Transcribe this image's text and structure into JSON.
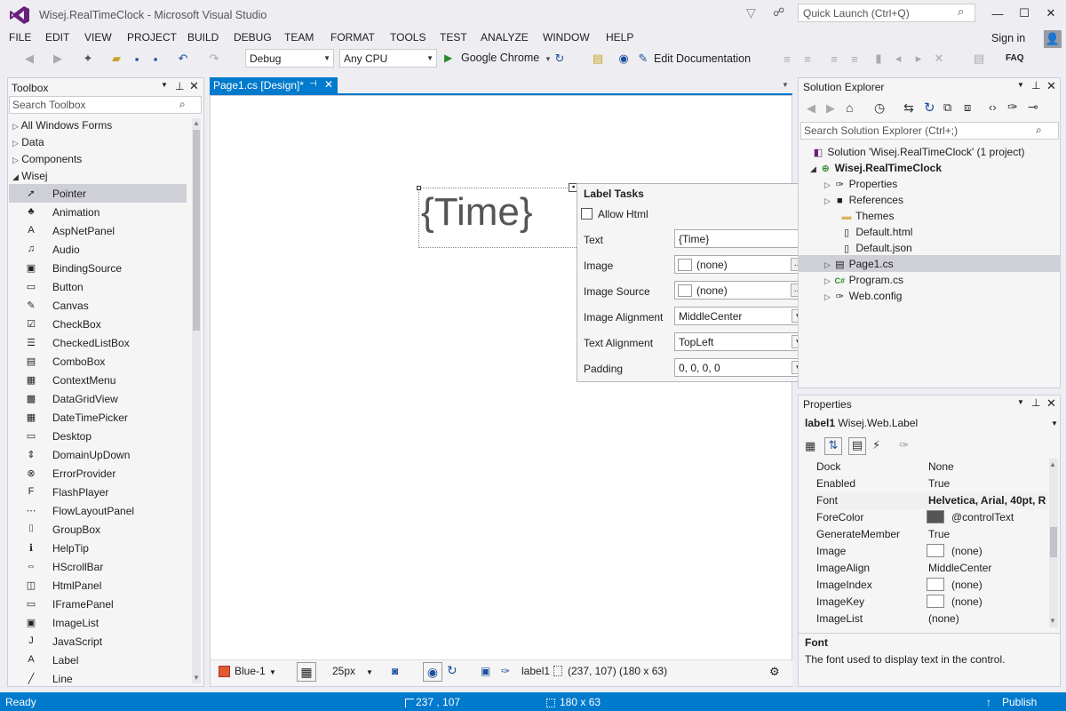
{
  "window": {
    "title": "Wisej.RealTimeClock - Microsoft Visual Studio",
    "quick_launch_placeholder": "Quick Launch (Ctrl+Q)"
  },
  "menu": [
    "FILE",
    "EDIT",
    "VIEW",
    "PROJECT",
    "BUILD",
    "DEBUG",
    "TEAM",
    "FORMAT",
    "TOOLS",
    "TEST",
    "ANALYZE",
    "WINDOW",
    "HELP"
  ],
  "signin": "Sign in",
  "toolbar": {
    "config": "Debug",
    "platform": "Any CPU",
    "run_target": "Google Chrome",
    "edit_doc": "Edit Documentation",
    "faq": "FAQ"
  },
  "toolbox": {
    "title": "Toolbox",
    "search_placeholder": "Search Toolbox",
    "groups": [
      "All Windows Forms",
      "Data",
      "Components",
      "Wisej"
    ],
    "items": [
      {
        "label": "Pointer",
        "icon": "pointer-icon",
        "glyph": "➚"
      },
      {
        "label": "Animation",
        "icon": "animation-icon",
        "glyph": "♣"
      },
      {
        "label": "AspNetPanel",
        "icon": "asp-icon",
        "glyph": "A"
      },
      {
        "label": "Audio",
        "icon": "audio-icon",
        "glyph": "♫"
      },
      {
        "label": "BindingSource",
        "icon": "binding-icon",
        "glyph": "▣"
      },
      {
        "label": "Button",
        "icon": "button-icon",
        "glyph": "▭"
      },
      {
        "label": "Canvas",
        "icon": "canvas-icon",
        "glyph": "✎"
      },
      {
        "label": "CheckBox",
        "icon": "checkbox-icon",
        "glyph": "☑"
      },
      {
        "label": "CheckedListBox",
        "icon": "checkedlist-icon",
        "glyph": "☰"
      },
      {
        "label": "ComboBox",
        "icon": "combobox-icon",
        "glyph": "▤"
      },
      {
        "label": "ContextMenu",
        "icon": "contextmenu-icon",
        "glyph": "▦"
      },
      {
        "label": "DataGridView",
        "icon": "datagrid-icon",
        "glyph": "▩"
      },
      {
        "label": "DateTimePicker",
        "icon": "datetime-icon",
        "glyph": "▦"
      },
      {
        "label": "Desktop",
        "icon": "desktop-icon",
        "glyph": "▭"
      },
      {
        "label": "DomainUpDown",
        "icon": "domainupdown-icon",
        "glyph": "⇕"
      },
      {
        "label": "ErrorProvider",
        "icon": "error-icon",
        "glyph": "⊗"
      },
      {
        "label": "FlashPlayer",
        "icon": "flash-icon",
        "glyph": "F"
      },
      {
        "label": "FlowLayoutPanel",
        "icon": "flowlayout-icon",
        "glyph": "⋯"
      },
      {
        "label": "GroupBox",
        "icon": "groupbox-icon",
        "glyph": "⌷"
      },
      {
        "label": "HelpTip",
        "icon": "helptip-icon",
        "glyph": "ℹ"
      },
      {
        "label": "HScrollBar",
        "icon": "hscroll-icon",
        "glyph": "⇔"
      },
      {
        "label": "HtmlPanel",
        "icon": "html-icon",
        "glyph": "◫"
      },
      {
        "label": "IFramePanel",
        "icon": "iframe-icon",
        "glyph": "▭"
      },
      {
        "label": "ImageList",
        "icon": "imagelist-icon",
        "glyph": "▣"
      },
      {
        "label": "JavaScript",
        "icon": "javascript-icon",
        "glyph": "J"
      },
      {
        "label": "Label",
        "icon": "label-icon",
        "glyph": "A"
      },
      {
        "label": "Line",
        "icon": "line-icon",
        "glyph": "╱"
      }
    ]
  },
  "designer": {
    "tab": "Page1.cs [Design]*",
    "label_text": "{Time}",
    "tasks": {
      "title": "Label Tasks",
      "allow_html": "Allow Html",
      "rows": [
        {
          "name": "Text",
          "value": "{Time}"
        },
        {
          "name": "Image",
          "value": "(none)"
        },
        {
          "name": "Image Source",
          "value": "(none)"
        },
        {
          "name": "Image Alignment",
          "value": "MiddleCenter"
        },
        {
          "name": "Text Alignment",
          "value": "TopLeft"
        },
        {
          "name": "Padding",
          "value": "0, 0, 0, 0"
        }
      ]
    },
    "bottom": {
      "theme": "Blue-1",
      "grid": "25px",
      "component": "label1",
      "geometry": "(237, 107) (180 x 63)"
    }
  },
  "solution_explorer": {
    "title": "Solution Explorer",
    "search_placeholder": "Search Solution Explorer (Ctrl+;)",
    "items": [
      "Solution 'Wisej.RealTimeClock' (1 project)",
      "Wisej.RealTimeClock",
      "Properties",
      "References",
      "Themes",
      "Default.html",
      "Default.json",
      "Page1.cs",
      "Program.cs",
      "Web.config"
    ]
  },
  "properties": {
    "title": "Properties",
    "object": "label1",
    "type": "Wisej.Web.Label",
    "rows": [
      {
        "name": "Dock",
        "value": "None"
      },
      {
        "name": "Enabled",
        "value": "True"
      },
      {
        "name": "Font",
        "value": "Helvetica, Arial, 40pt, R"
      },
      {
        "name": "ForeColor",
        "value": "@controlText"
      },
      {
        "name": "GenerateMember",
        "value": "True"
      },
      {
        "name": "Image",
        "value": "(none)"
      },
      {
        "name": "ImageAlign",
        "value": "MiddleCenter"
      },
      {
        "name": "ImageIndex",
        "value": "(none)"
      },
      {
        "name": "ImageKey",
        "value": "(none)"
      },
      {
        "name": "ImageList",
        "value": "(none)"
      }
    ],
    "desc_title": "Font",
    "desc_text": "The font used to display text in the control."
  },
  "status": {
    "ready": "Ready",
    "pos": "237 , 107",
    "size": "180 x 63",
    "publish": "Publish"
  }
}
